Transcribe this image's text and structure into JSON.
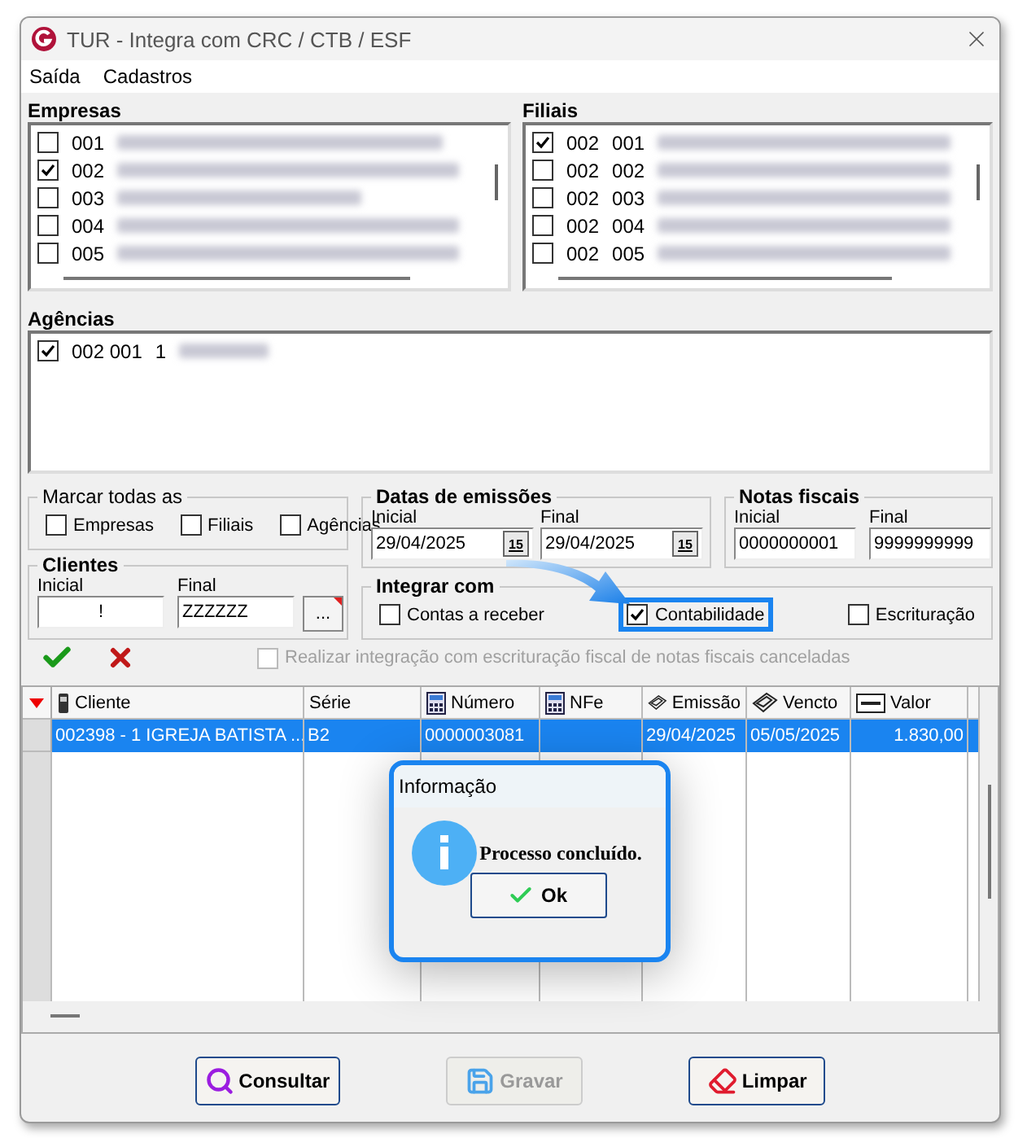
{
  "window": {
    "title": "TUR - Integra com CRC / CTB / ESF"
  },
  "menu": [
    "Saída",
    "Cadastros"
  ],
  "empresas": {
    "label": "Empresas",
    "items": [
      {
        "code": "001",
        "checked": false
      },
      {
        "code": "002",
        "checked": true
      },
      {
        "code": "003",
        "checked": false
      },
      {
        "code": "004",
        "checked": false
      },
      {
        "code": "005",
        "checked": false
      }
    ]
  },
  "filiais": {
    "label": "Filiais",
    "items": [
      {
        "code": "002",
        "branch": "001",
        "checked": true
      },
      {
        "code": "002",
        "branch": "002",
        "checked": false
      },
      {
        "code": "002",
        "branch": "003",
        "checked": false
      },
      {
        "code": "002",
        "branch": "004",
        "checked": false
      },
      {
        "code": "002",
        "branch": "005",
        "checked": false
      }
    ]
  },
  "agencias": {
    "label": "Agências",
    "items": [
      {
        "code": "002 001",
        "number": "1",
        "checked": true
      }
    ]
  },
  "marcar_todas": {
    "label": "Marcar todas as",
    "options": [
      {
        "label": "Empresas",
        "checked": false
      },
      {
        "label": "Filiais",
        "checked": false
      },
      {
        "label": "Agências",
        "checked": false
      }
    ]
  },
  "clientes": {
    "label": "Clientes",
    "initial_label": "Inicial",
    "initial": "!",
    "final_label": "Final",
    "final": "ZZZZZZ",
    "lookup_button": "..."
  },
  "datas": {
    "label": "Datas de emissões",
    "initial_label": "Inicial",
    "initial": "29/04/2025",
    "final_label": "Final",
    "final": "29/04/2025",
    "initial_button": "15",
    "final_button": "15"
  },
  "notas": {
    "label": "Notas fiscais",
    "initial_label": "Inicial",
    "initial": "0000000001",
    "final_label": "Final",
    "final": "9999999999"
  },
  "integrar": {
    "label": "Integrar com",
    "options": [
      {
        "label": "Contas a receber",
        "checked": false,
        "highlighted": false
      },
      {
        "label": "Contabilidade",
        "checked": true,
        "highlighted": true
      },
      {
        "label": "Escrituração",
        "checked": false,
        "highlighted": false
      }
    ]
  },
  "cancelled_option": {
    "label": "Realizar integração com escrituração fiscal de notas fiscais canceladas",
    "checked": false,
    "disabled": true
  },
  "table": {
    "columns": [
      {
        "label": "Cliente",
        "kind": "phone"
      },
      {
        "label": "Série",
        "kind": "plain"
      },
      {
        "label": "Número",
        "kind": "calc"
      },
      {
        "label": "NFe",
        "kind": "calc"
      },
      {
        "label": "Emissão",
        "kind": "money"
      },
      {
        "label": "Vencto",
        "kind": "money"
      },
      {
        "label": "Valor",
        "kind": "card"
      }
    ],
    "rows": [
      {
        "selected": true,
        "cells": [
          "002398 - 1 IGREJA BATISTA ...",
          "B2",
          "0000003081",
          "",
          "29/04/2025",
          "05/05/2025",
          "1.830,00"
        ]
      }
    ]
  },
  "dialog": {
    "title": "Informação",
    "message": "Processo concluído.",
    "button": "Ok"
  },
  "buttons": [
    {
      "label": "Consultar",
      "kind": "search",
      "disabled": false
    },
    {
      "label": "Gravar",
      "kind": "save",
      "disabled": true
    },
    {
      "label": "Limpar",
      "kind": "clear",
      "disabled": false
    }
  ]
}
